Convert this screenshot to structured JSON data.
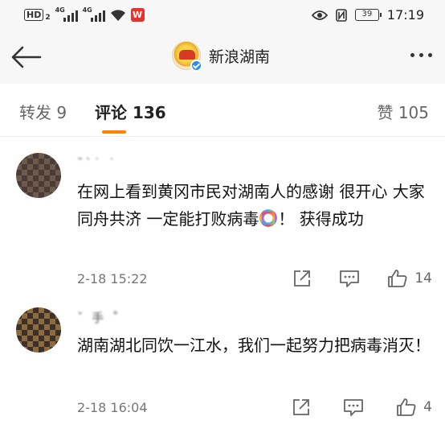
{
  "status_bar": {
    "left": {
      "hd_label": "HD",
      "hd_sub": "2",
      "network_1": "4G",
      "network_2": "4G",
      "app_badge": "W"
    },
    "right": {
      "battery": "39",
      "time": "17:19"
    }
  },
  "header": {
    "title": "新浪湖南"
  },
  "tabs": {
    "repost": "转发 9",
    "comments": "评论 136",
    "likes": "赞 105",
    "active": "comments",
    "accent_color": "#ff8200"
  },
  "comments": [
    {
      "name": "˘ˋ˙ ˙",
      "text_before_emoji": "在网上看到黄冈市民对湖南人的感谢 很开心 大家同舟共济 一定能打败病毒",
      "text_after_emoji": "！ 获得成功",
      "emoji": "ribbon-emoji",
      "time": "2-18 15:22",
      "likes": "14"
    },
    {
      "name": "ˇ 手 ˚",
      "text": "湖南湖北同饮一江水，我们一起努力把病毒消灭！",
      "time": "2-18 16:04",
      "likes": "4"
    }
  ],
  "icons": {
    "back": "back-arrow-icon",
    "more": "more-icon",
    "share": "share-icon",
    "reply": "comment-icon",
    "like": "thumbs-up-icon"
  }
}
